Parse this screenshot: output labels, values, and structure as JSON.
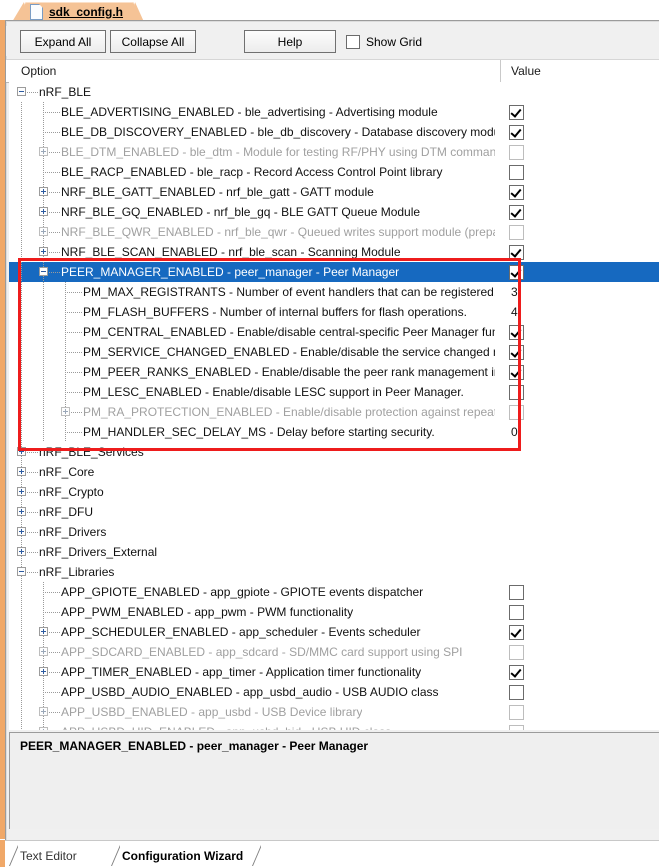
{
  "document_tab": {
    "label": "sdk_config.h",
    "icon": "document-icon"
  },
  "toolbar": {
    "expand_all": "Expand All",
    "collapse_all": "Collapse All",
    "help": "Help",
    "show_grid_label": "Show Grid",
    "show_grid_checked": false
  },
  "columns": {
    "option": "Option",
    "value": "Value"
  },
  "colors": {
    "selection": "#1669c0",
    "annotation": "#ee1c1c",
    "accent": "#f0a868",
    "tab_bg": "#f5c396"
  },
  "annotation": {
    "shape": "rectangle",
    "color": "#ee1c1c"
  },
  "description_pane": {
    "text": "PEER_MANAGER_ENABLED - peer_manager - Peer Manager"
  },
  "bottom_tabs": [
    {
      "label": "Text Editor",
      "active": false
    },
    {
      "label": "Configuration Wizard",
      "active": true
    }
  ],
  "tree": [
    {
      "label": "nRF_BLE",
      "depth": 0,
      "expander": "minus",
      "value": "none",
      "dim": false,
      "selected": false
    },
    {
      "label": "BLE_ADVERTISING_ENABLED  - ble_advertising - Advertising module",
      "depth": 1,
      "expander": "none",
      "value": "checked",
      "dim": false,
      "selected": false
    },
    {
      "label": "BLE_DB_DISCOVERY_ENABLED  - ble_db_discovery - Database discovery module",
      "depth": 1,
      "expander": "none",
      "value": "checked",
      "dim": false,
      "selected": false
    },
    {
      "label": "BLE_DTM_ENABLED - ble_dtm - Module for testing RF/PHY using DTM commands",
      "depth": 1,
      "expander": "plus",
      "value": "unchecked",
      "dim": true,
      "selected": false
    },
    {
      "label": "BLE_RACP_ENABLED  - ble_racp - Record Access Control Point library",
      "depth": 1,
      "expander": "none",
      "value": "unchecked",
      "dim": false,
      "selected": false
    },
    {
      "label": "NRF_BLE_GATT_ENABLED - nrf_ble_gatt - GATT module",
      "depth": 1,
      "expander": "plus",
      "value": "checked",
      "dim": false,
      "selected": false
    },
    {
      "label": "NRF_BLE_GQ_ENABLED - nrf_ble_gq - BLE GATT Queue Module",
      "depth": 1,
      "expander": "plus",
      "value": "checked",
      "dim": false,
      "selected": false
    },
    {
      "label": "NRF_BLE_QWR_ENABLED - nrf_ble_qwr - Queued writes support module (prepare/...",
      "depth": 1,
      "expander": "plus",
      "value": "unchecked",
      "dim": true,
      "selected": false
    },
    {
      "label": "NRF_BLE_SCAN_ENABLED - nrf_ble_scan - Scanning Module",
      "depth": 1,
      "expander": "plus",
      "value": "checked",
      "dim": false,
      "selected": false
    },
    {
      "label": "PEER_MANAGER_ENABLED - peer_manager - Peer Manager",
      "depth": 1,
      "expander": "minus",
      "value": "checked",
      "dim": false,
      "selected": true
    },
    {
      "label": "PM_MAX_REGISTRANTS - Number of event handlers that can be registered.",
      "depth": 2,
      "expander": "none",
      "value": "3",
      "dim": false,
      "selected": false
    },
    {
      "label": "PM_FLASH_BUFFERS - Number of internal buffers for flash operations.",
      "depth": 2,
      "expander": "none",
      "value": "4",
      "dim": false,
      "selected": false
    },
    {
      "label": "PM_CENTRAL_ENABLED  - Enable/disable central-specific Peer Manager funct...",
      "depth": 2,
      "expander": "none",
      "value": "checked",
      "dim": false,
      "selected": false
    },
    {
      "label": "PM_SERVICE_CHANGED_ENABLED  - Enable/disable the service changed man...",
      "depth": 2,
      "expander": "none",
      "value": "checked",
      "dim": false,
      "selected": false
    },
    {
      "label": "PM_PEER_RANKS_ENABLED  - Enable/disable the peer rank management in Pe...",
      "depth": 2,
      "expander": "none",
      "value": "checked",
      "dim": false,
      "selected": false
    },
    {
      "label": "PM_LESC_ENABLED  - Enable/disable LESC support in Peer Manager.",
      "depth": 2,
      "expander": "none",
      "value": "unchecked",
      "dim": false,
      "selected": false
    },
    {
      "label": "PM_RA_PROTECTION_ENABLED - Enable/disable protection against repeated ...",
      "depth": 2,
      "expander": "plus",
      "value": "unchecked",
      "dim": true,
      "selected": false
    },
    {
      "label": "PM_HANDLER_SEC_DELAY_MS - Delay before starting security.",
      "depth": 2,
      "expander": "none",
      "value": "0",
      "dim": false,
      "selected": false
    },
    {
      "label": "nRF_BLE_Services",
      "depth": 0,
      "expander": "plus",
      "value": "none",
      "dim": false,
      "selected": false
    },
    {
      "label": "nRF_Core",
      "depth": 0,
      "expander": "plus",
      "value": "none",
      "dim": false,
      "selected": false
    },
    {
      "label": "nRF_Crypto",
      "depth": 0,
      "expander": "plus",
      "value": "none",
      "dim": false,
      "selected": false
    },
    {
      "label": "nRF_DFU",
      "depth": 0,
      "expander": "plus",
      "value": "none",
      "dim": false,
      "selected": false
    },
    {
      "label": "nRF_Drivers",
      "depth": 0,
      "expander": "plus",
      "value": "none",
      "dim": false,
      "selected": false
    },
    {
      "label": "nRF_Drivers_External",
      "depth": 0,
      "expander": "plus",
      "value": "none",
      "dim": false,
      "selected": false
    },
    {
      "label": "nRF_Libraries",
      "depth": 0,
      "expander": "minus",
      "value": "none",
      "dim": false,
      "selected": false
    },
    {
      "label": "APP_GPIOTE_ENABLED  - app_gpiote - GPIOTE events dispatcher",
      "depth": 1,
      "expander": "none",
      "value": "unchecked",
      "dim": false,
      "selected": false
    },
    {
      "label": "APP_PWM_ENABLED  - app_pwm - PWM functionality",
      "depth": 1,
      "expander": "none",
      "value": "unchecked",
      "dim": false,
      "selected": false
    },
    {
      "label": "APP_SCHEDULER_ENABLED - app_scheduler - Events scheduler",
      "depth": 1,
      "expander": "plus",
      "value": "checked",
      "dim": false,
      "selected": false
    },
    {
      "label": "APP_SDCARD_ENABLED - app_sdcard - SD/MMC card support using SPI",
      "depth": 1,
      "expander": "plus",
      "value": "unchecked",
      "dim": true,
      "selected": false
    },
    {
      "label": "APP_TIMER_ENABLED - app_timer - Application timer functionality",
      "depth": 1,
      "expander": "plus",
      "value": "checked",
      "dim": false,
      "selected": false
    },
    {
      "label": "APP_USBD_AUDIO_ENABLED  - app_usbd_audio - USB AUDIO class",
      "depth": 1,
      "expander": "none",
      "value": "unchecked",
      "dim": false,
      "selected": false
    },
    {
      "label": "APP_USBD_ENABLED - app_usbd - USB Device library",
      "depth": 1,
      "expander": "plus",
      "value": "unchecked",
      "dim": true,
      "selected": false
    },
    {
      "label": "APP_USBD_HID_ENABLED - app_usbd_hid - USB HID class",
      "depth": 1,
      "expander": "plus",
      "value": "unchecked",
      "dim": true,
      "selected": false
    }
  ]
}
